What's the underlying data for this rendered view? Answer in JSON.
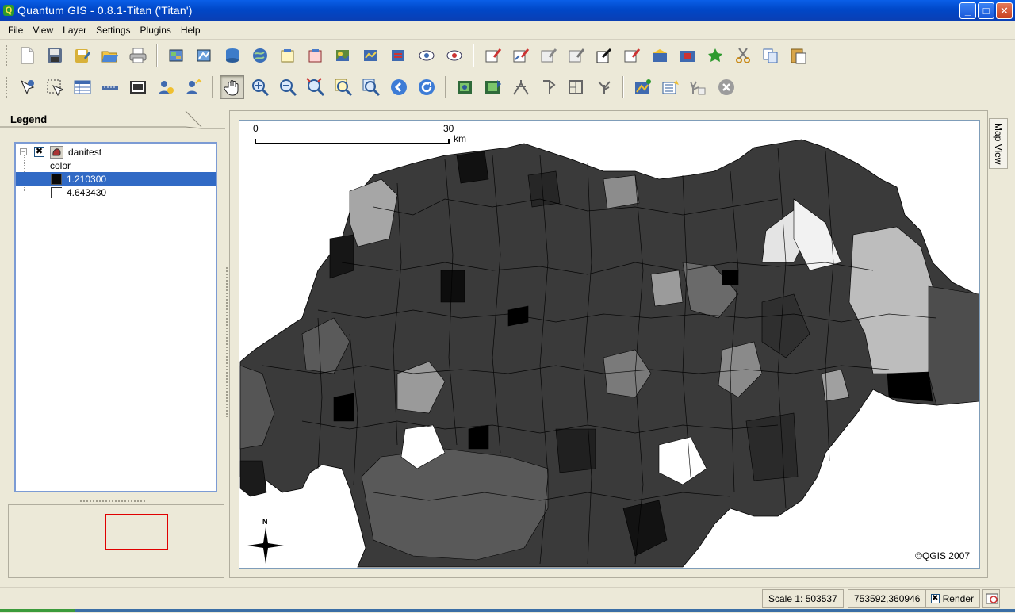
{
  "window": {
    "title": "Quantum GIS - 0.8.1-Titan ('Titan')",
    "app_icon_glyph": "Q",
    "min_glyph": "_",
    "max_glyph": "□",
    "close_glyph": "✕"
  },
  "menu": [
    "File",
    "View",
    "Layer",
    "Settings",
    "Plugins",
    "Help"
  ],
  "toolbar1": [
    "new-project-icon",
    "save-project-icon",
    "save-project-as-icon",
    "open-project-icon",
    "print-icon",
    "add-raster-icon",
    "add-vector-icon",
    "add-postgis-icon",
    "add-wms-icon",
    "new-layer-icon",
    "remove-layer-icon",
    "show-all-icon",
    "hide-all-icon",
    "overview-add-icon",
    "overview-remove-icon",
    "show-layers-icon",
    "capture-point-icon",
    "capture-line-icon",
    "capture-polygon-icon",
    "delete-selected-icon",
    "move-feature-icon",
    "add-ring-icon",
    "add-island-icon",
    "split-feature-icon",
    "add-vertex-icon",
    "cut-features-icon",
    "copy-features-icon",
    "paste-features-icon"
  ],
  "toolbar2": [
    "identify-icon",
    "select-icon",
    "attribute-table-icon",
    "measure-line-icon",
    "measure-area-icon",
    "map-tips-icon",
    "spatial-bookmark-icon",
    "pan-icon",
    "zoom-in-icon",
    "zoom-out-icon",
    "zoom-full-icon",
    "zoom-selection-icon",
    "zoom-layer-icon",
    "zoom-last-icon",
    "refresh-icon",
    "georeferencer-icon",
    "grid-maker-icon",
    "north-arrow-icon",
    "scale-bar-icon",
    "copyright-label-icon",
    "gps-icon",
    "plugin-manager-icon",
    "add-delimited-text-icon",
    "quick-print-icon",
    "stop-render-icon"
  ],
  "legend": {
    "title": "Legend",
    "layer_name": "danitest",
    "classification_field": "color",
    "classes": [
      {
        "label": "1.210300",
        "color": "#0a0a0a",
        "selected": true
      },
      {
        "label": "4.643430",
        "color": "#ffffff",
        "selected": false
      }
    ]
  },
  "map": {
    "tab_label": "Map View",
    "scalebar_start": "0",
    "scalebar_end": "30",
    "scalebar_unit": "km",
    "north_label": "N",
    "copyright": "©QGIS 2007"
  },
  "status": {
    "scale": "Scale 1: 503537",
    "coordinates": "753592,360946",
    "render_label": "Render",
    "render_checked": "✖"
  },
  "colors": {
    "titlebar": "#0a5fe8",
    "selection": "#316ac5",
    "overview_extent": "#e00000"
  }
}
